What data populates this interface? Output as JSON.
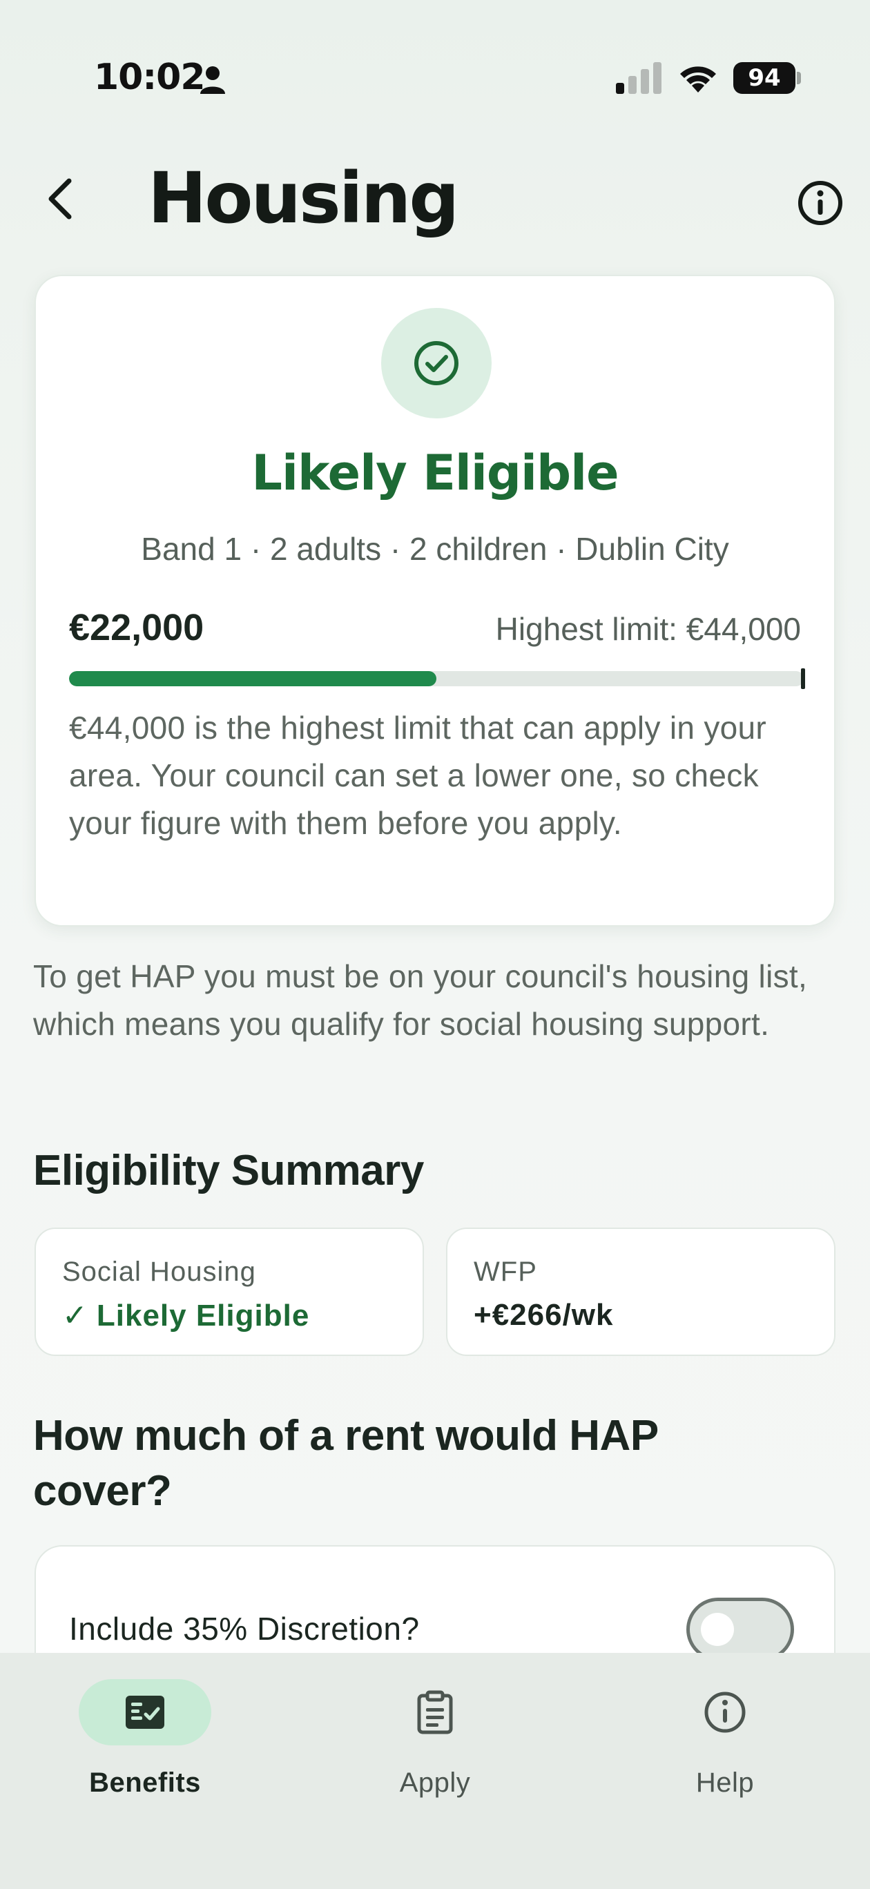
{
  "status_bar": {
    "time": "10:02",
    "battery": "94"
  },
  "header": {
    "title": "Housing"
  },
  "result_card": {
    "heading": "Likely Eligible",
    "subtitle": "Band 1 · 2 adults · 2 children · Dublin City",
    "income_value": "€22,000",
    "limit_label": "Highest limit: €44,000",
    "progress_fraction": 0.5,
    "note": "€44,000 is the highest limit that can apply in your area. Your council can set a lower one, so check your figure with them before you apply."
  },
  "hap_note": "To get HAP you must be on your council's housing list, which means you qualify for social housing support.",
  "summary": {
    "title": "Eligibility Summary",
    "tiles": [
      {
        "label": "Social Housing",
        "value": "Likely Eligible",
        "check": "✓"
      },
      {
        "label": "WFP",
        "value": "+€266/wk"
      }
    ]
  },
  "hap_section": {
    "title": "How much of a rent would HAP cover?",
    "discretion_label": "Include 35% Discretion?",
    "discretion_enabled": false
  },
  "bottom_nav": {
    "items": [
      {
        "label": "Benefits",
        "icon": "benefits-icon",
        "active": true
      },
      {
        "label": "Apply",
        "icon": "clipboard-icon",
        "active": false
      },
      {
        "label": "Help",
        "icon": "info-icon",
        "active": false
      }
    ]
  },
  "colors": {
    "accent_green": "#1d6a35",
    "progress_green": "#1f8a4c",
    "badge_bg": "#dcefe3",
    "nav_active_pill": "#c8ebd6"
  }
}
